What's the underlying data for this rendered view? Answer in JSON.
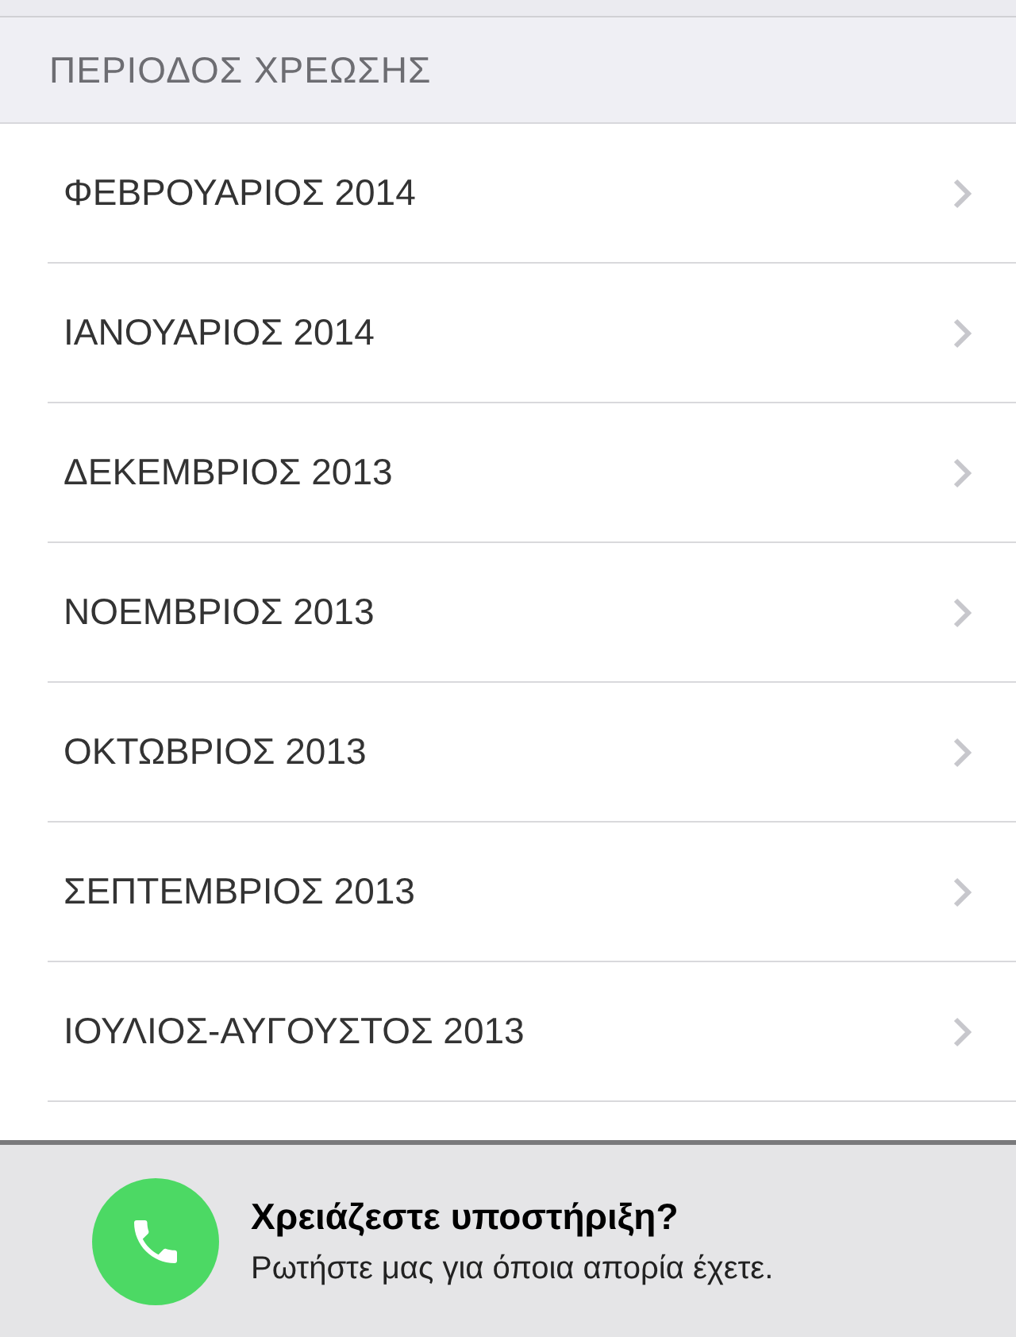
{
  "section_header": "ΠΕΡΙΟΔΟΣ ΧΡΕΩΣΗΣ",
  "periods": [
    {
      "label": "ΦΕΒΡΟΥΑΡΙΟΣ 2014"
    },
    {
      "label": "ΙΑΝΟΥΑΡΙΟΣ 2014"
    },
    {
      "label": "ΔΕΚΕΜΒΡΙΟΣ 2013"
    },
    {
      "label": "ΝΟΕΜΒΡΙΟΣ 2013"
    },
    {
      "label": "ΟΚΤΩΒΡΙΟΣ 2013"
    },
    {
      "label": "ΣΕΠΤΕΜΒΡΙΟΣ 2013"
    },
    {
      "label": "ΙΟΥΛΙΟΣ-ΑΥΓΟΥΣΤΟΣ 2013"
    }
  ],
  "support": {
    "title": "Χρειάζεστε υποστήριξη?",
    "subtitle": "Ρωτήστε μας για όποια απορία έχετε."
  }
}
